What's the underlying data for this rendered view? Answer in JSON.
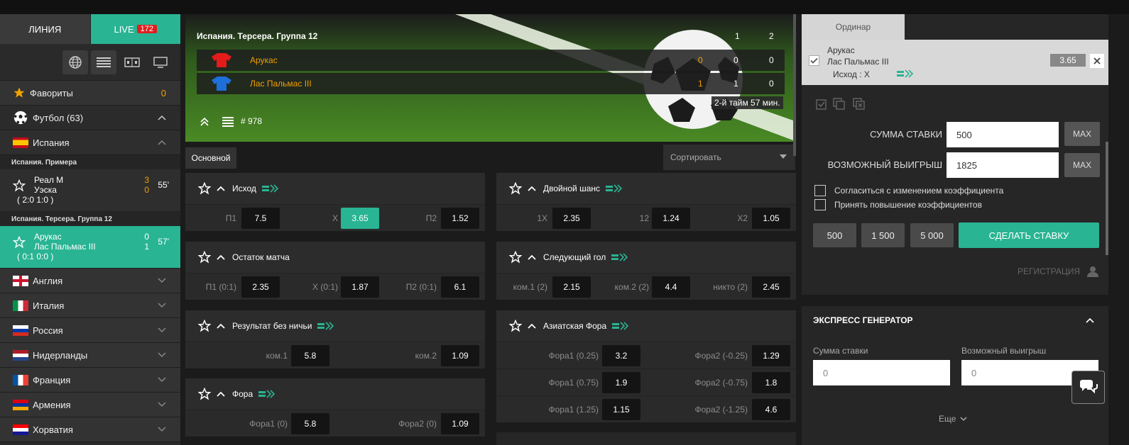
{
  "sidebar": {
    "tabs": {
      "line": "ЛИНИЯ",
      "live": "LIVE",
      "live_count": "172"
    },
    "favorites": {
      "label": "Фавориты",
      "count": "0"
    },
    "sport": {
      "label": "Футбол (63)"
    },
    "countries_top": {
      "label": "Испания"
    },
    "league1": "Испания. Примера",
    "match1": {
      "team1": "Реал М",
      "team2": "Уэска",
      "score1": "3",
      "score2": "0",
      "minute": "55'",
      "halves": "( 2:0  1:0 )"
    },
    "league2": "Испания. Терсера. Группа 12",
    "match2": {
      "team1": "Арукас",
      "team2": "Лас Пальмас III",
      "score1": "0",
      "score2": "1",
      "minute": "57'",
      "halves": "( 0:1  0:0 )"
    },
    "countries": [
      "Англия",
      "Италия",
      "Россия",
      "Нидерланды",
      "Франция",
      "Армения",
      "Хорватия"
    ]
  },
  "banner": {
    "title": "Испания. Терсера. Группа 12",
    "col1": "1",
    "col2": "2",
    "team1": {
      "name": "Арукас",
      "s1": "0",
      "s2": "0",
      "s3": "0"
    },
    "team2": {
      "name": "Лас Пальмас III",
      "s1": "1",
      "s2": "1",
      "s3": "0"
    },
    "period": "2-й тайм  57 мин.",
    "match_id": "# 978"
  },
  "center": {
    "submenu": "Основной",
    "sort": "Сортировать"
  },
  "markets": {
    "m1": {
      "title": "Исход",
      "o1l": "П1",
      "o1": "7.5",
      "o2l": "Х",
      "o2": "3.65",
      "o3l": "П2",
      "o3": "1.52"
    },
    "m2": {
      "title": "Двойной шанс",
      "o1l": "1Х",
      "o1": "2.35",
      "o2l": "12",
      "o2": "1.24",
      "o3l": "Х2",
      "o3": "1.05"
    },
    "m3": {
      "title": "Остаток матча",
      "o1l": "П1 (0:1)",
      "o1": "2.35",
      "o2l": "Х (0:1)",
      "o2": "1.87",
      "o3l": "П2 (0:1)",
      "o3": "6.1"
    },
    "m4": {
      "title": "Следующий гол",
      "o1l": "ком.1 (2)",
      "o1": "2.15",
      "o2l": "ком.2 (2)",
      "o2": "4.4",
      "o3l": "никто (2)",
      "o3": "2.45"
    },
    "m5": {
      "title": "Результат без ничьи",
      "o1l": "ком.1",
      "o1": "5.8",
      "o2l": "ком.2",
      "o2": "1.09"
    },
    "m6": {
      "title": "Азиатская Фора",
      "rows": [
        {
          "l1": "Фора1 (0.25)",
          "v1": "3.2",
          "l2": "Фора2 (-0.25)",
          "v2": "1.29"
        },
        {
          "l1": "Фора1 (0.75)",
          "v1": "1.9",
          "l2": "Фора2 (-0.75)",
          "v2": "1.8"
        },
        {
          "l1": "Фора1 (1.25)",
          "v1": "1.15",
          "l2": "Фора2 (-1.25)",
          "v2": "4.6"
        }
      ]
    },
    "m7": {
      "title": "Фора",
      "o1l": "Фора1 (0)",
      "o1": "5.8",
      "o2l": "Фора2 (0)",
      "o2": "1.09"
    }
  },
  "betslip": {
    "tab": "Ординар",
    "team1": "Арукас",
    "team2": "Лас Пальмас III",
    "outcome": "Исход : Х",
    "odd": "3.65",
    "stake_label": "СУММА СТАВКИ",
    "stake_value": "500",
    "win_label": "ВОЗМОЖНЫЙ ВЫИГРЫШ",
    "win_value": "1825",
    "max": "MAX",
    "agree_change": "Согласиться с изменением коэффициента",
    "accept_raise": "Принять повышение коэффициентов",
    "quick": [
      "500",
      "1 500",
      "5 000"
    ],
    "make_bet": "СДЕЛАТЬ СТАВКУ",
    "register": "РЕГИСТРАЦИЯ"
  },
  "express": {
    "title": "ЭКСПРЕСС ГЕНЕРАТОР",
    "stake_label": "Сумма ставки",
    "win_label": "Возможный выигрыш",
    "stake_placeholder": "0",
    "win_placeholder": "0",
    "more": "Еще"
  },
  "colors": {
    "accent": "#29b493",
    "odds_highlight": "#f0a000",
    "live_badge": "#e21e1e"
  }
}
